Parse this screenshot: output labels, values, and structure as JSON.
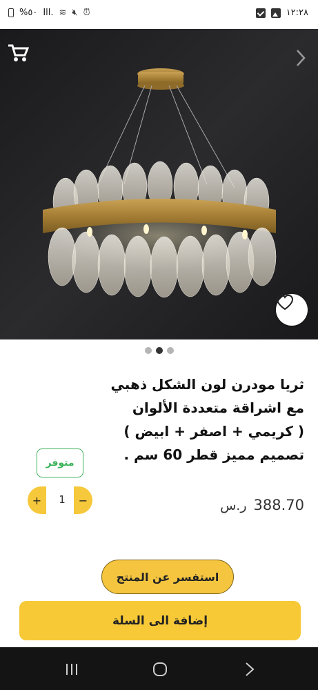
{
  "status_bar": {
    "time": "١٢:٢٨",
    "battery": "%٥٠",
    "signal": "Ill."
  },
  "product": {
    "title_lines": [
      "ثريا مودرن لون الشكل ذهبي",
      "مع اشراقة متعددة الألوان",
      "( كريمي + اصفر + ابيض )",
      "تصميم مميز قطر 60 سم ."
    ],
    "price": "388.70",
    "currency": "ر.س",
    "availability": "متوفر",
    "quantity": "1",
    "qty_plus": "+",
    "qty_minus": "−"
  },
  "gallery": {
    "total_images": 3,
    "active_index": 1
  },
  "actions": {
    "inquiry_label": "استفسر عن المنتج",
    "add_to_cart_label": "إضافة الى السلة"
  },
  "icons": {
    "cart": "shopping-cart-icon",
    "next": "chevron-right-icon",
    "favorite": "heart-icon"
  },
  "colors": {
    "accent_yellow": "#f6c83b",
    "available_green": "#3db35a",
    "hero_background": "#1f1f21",
    "nav_bar": "#141414"
  }
}
